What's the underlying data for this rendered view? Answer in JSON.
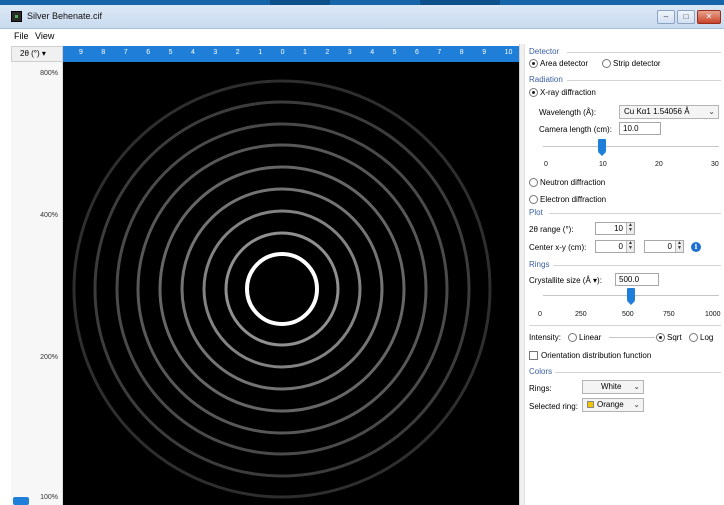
{
  "window": {
    "title": "Silver Behenate.cif",
    "minimize": "–",
    "maximize": "□",
    "close": "✕"
  },
  "menu": [
    "File",
    "View"
  ],
  "zoom_header": "2θ (°) ▾",
  "ruler_top": [
    "9",
    "8",
    "7",
    "6",
    "5",
    "4",
    "3",
    "2",
    "1",
    "0",
    "1",
    "2",
    "3",
    "4",
    "5",
    "6",
    "7",
    "8",
    "9",
    "10"
  ],
  "ruler_left": [
    "800%",
    "400%",
    "200%",
    "100%"
  ],
  "rings": {
    "count": 9,
    "highlight_index": 0
  },
  "detector": {
    "section": "Detector",
    "area": "Area detector",
    "strip": "Strip detector",
    "selected": "area"
  },
  "radiation": {
    "section": "Radiation",
    "xray": "X-ray diffraction",
    "wavelength_label": "Wavelength (Å):",
    "wavelength_value": "Cu Kα1 1.54056 Å",
    "camera_label": "Camera length (cm):",
    "camera_value": "10.0",
    "camera_scale": [
      "0",
      "10",
      "20",
      "30"
    ],
    "camera_slider_value": 10,
    "neutron": "Neutron diffraction",
    "electron": "Electron diffraction"
  },
  "plot": {
    "section": "Plot",
    "range_label": "2θ range (°):",
    "range_value": "10",
    "center_label": "Center x-y (cm):",
    "center_x": "0",
    "center_y": "0",
    "info": "i"
  },
  "rings_section": {
    "section": "Rings",
    "crystallite_label": "Crystallite size (Å ▾):",
    "crystallite_value": "500.0",
    "scale": [
      "0",
      "250",
      "500",
      "750",
      "1000"
    ],
    "slider_value": 500,
    "intensity_label": "Intensity:",
    "linear": "Linear",
    "sqrt": "Sqrt",
    "log": "Log",
    "intensity_selected": "sqrt",
    "odf": "Orientation distribution function"
  },
  "colors": {
    "section": "Colors",
    "rings_label": "Rings:",
    "rings_value": "White",
    "selected_label": "Selected ring:",
    "selected_value": "Orange",
    "orange_hex": "#f5c400",
    "accent_hex": "#1f7fd8"
  }
}
